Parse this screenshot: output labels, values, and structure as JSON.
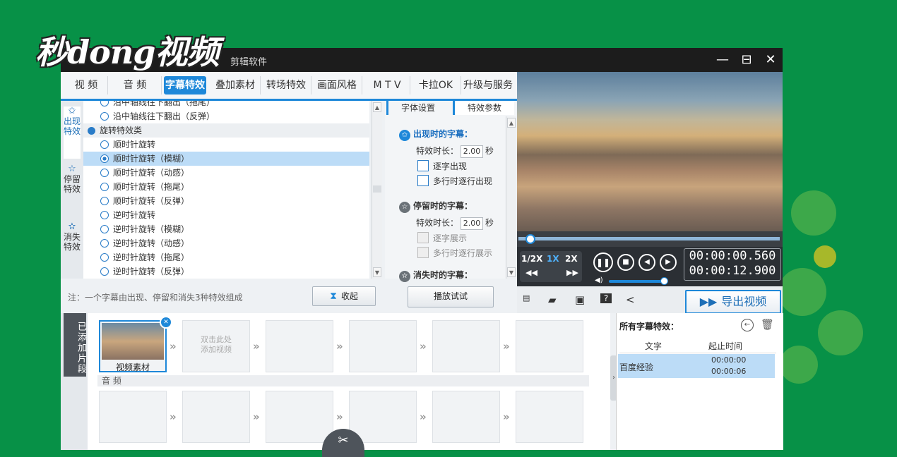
{
  "app": {
    "title_suffix": "剪辑软件",
    "logo": "秒dong视频",
    "minimize": "—",
    "maximize": "⊟",
    "close": "✕"
  },
  "tabs": [
    "视 频",
    "音 频",
    "字幕特效",
    "叠加素材",
    "转场特效",
    "画面风格",
    "M T V",
    "卡拉OK",
    "升级与服务"
  ],
  "active_tab": 2,
  "side_categories": [
    {
      "label": "出现特效",
      "icon": "star-in-icon"
    },
    {
      "label": "停留特效",
      "icon": "star-stay-icon"
    },
    {
      "label": "消失特效",
      "icon": "star-out-icon"
    }
  ],
  "effects": [
    {
      "label": "沿中轴线往下翻出（拖尾）",
      "type": "item"
    },
    {
      "label": "沿中轴线往下翻出（反弹）",
      "type": "item"
    },
    {
      "label": "旋转特效类",
      "type": "category"
    },
    {
      "label": "顺时针旋转",
      "type": "item"
    },
    {
      "label": "顺时针旋转（模糊）",
      "type": "selected"
    },
    {
      "label": "顺时针旋转（动感）",
      "type": "item"
    },
    {
      "label": "顺时针旋转（拖尾）",
      "type": "item"
    },
    {
      "label": "顺时针旋转（反弹）",
      "type": "item"
    },
    {
      "label": "逆时针旋转",
      "type": "item"
    },
    {
      "label": "逆时针旋转（模糊）",
      "type": "item"
    },
    {
      "label": "逆时针旋转（动感）",
      "type": "item"
    },
    {
      "label": "逆时针旋转（拖尾）",
      "type": "item"
    },
    {
      "label": "逆时针旋转（反弹）",
      "type": "item"
    }
  ],
  "params": {
    "tab_font": "字体设置",
    "tab_effect": "特效参数",
    "appear_title": "出现时的字幕：",
    "stay_title": "停留时的字幕：",
    "disappear_title": "消失时的字幕：",
    "duration_label": "特效时长：",
    "duration_unit": "秒",
    "appear_duration": "2.00",
    "stay_duration": "2.00",
    "appear_opt1": "逐字出现",
    "appear_opt2": "多行时逐行出现",
    "stay_opt1": "逐字展示",
    "stay_opt2": "多行时逐行展示"
  },
  "note": "注：一个字幕由出现、停留和消失3种特效组成",
  "collapse_btn": "收起",
  "play_test_btn": "播放试试",
  "player": {
    "speeds": [
      "1/2X",
      "1X",
      "2X"
    ],
    "active_speed": "1X",
    "time_current": "00:00:00.560",
    "time_total": "00:00:12.900",
    "volume": 0.75,
    "progress": 0.05
  },
  "export_btn": "导出视频",
  "timeline": {
    "side_tab": "已添加片段",
    "clip_label": "视频素材",
    "empty_hint": "双击此处\n添加视频",
    "audio_label": "音 频"
  },
  "subs_panel": {
    "title": "所有字幕特效：",
    "col_text": "文字",
    "col_time": "起止时间",
    "rows": [
      {
        "text": "百度经验",
        "start": "00:00:00",
        "end": "00:00:06"
      }
    ]
  },
  "colors": {
    "accent": "#1e88d9",
    "bg": "#079147",
    "selected": "#bcdcf7"
  }
}
